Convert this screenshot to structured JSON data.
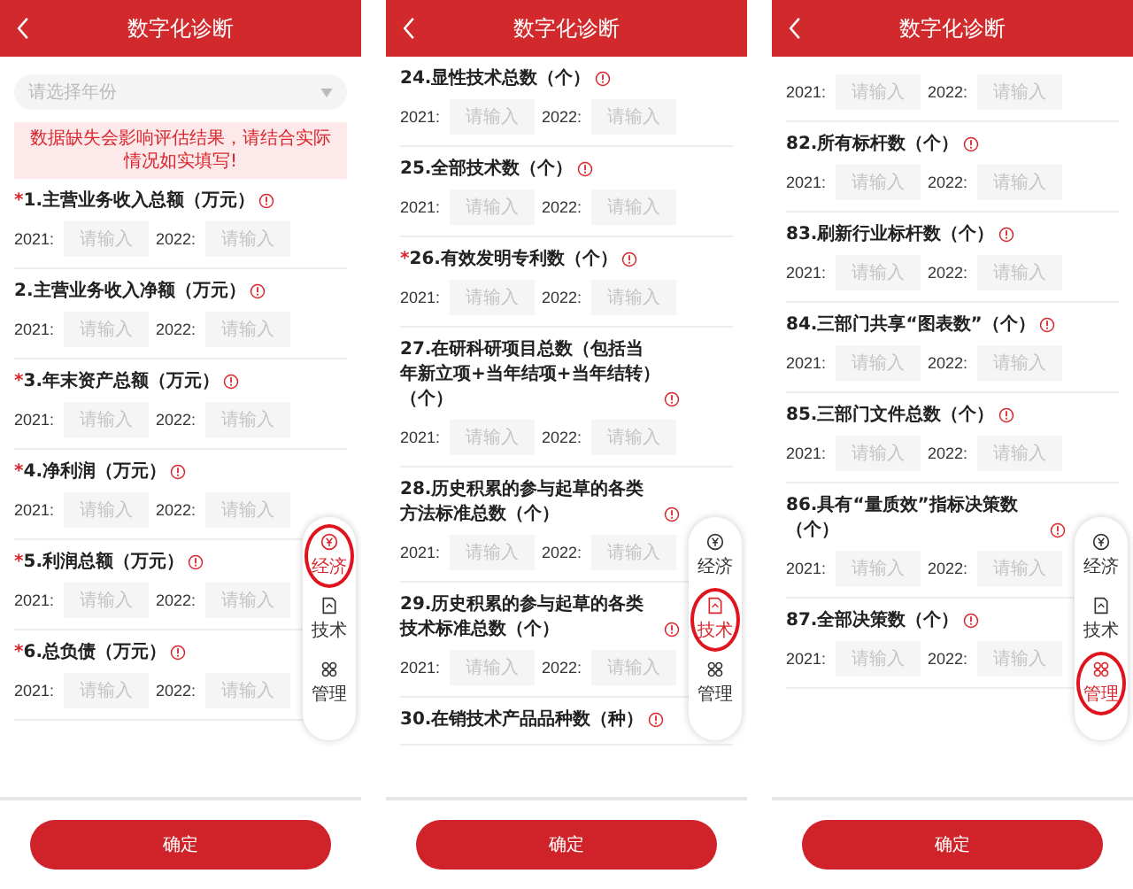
{
  "panels": [
    {
      "title": "数字化诊断",
      "year_select": {
        "placeholder": "请选择年份"
      },
      "notice": "数据缺失会影响评估结果，请结合实际情况如实填写!",
      "questions": [
        {
          "mark": "*",
          "label": "1.主营业务收入总额（万元）",
          "inputs": [
            {
              "year": "2021:",
              "placeholder": "请输入"
            },
            {
              "year": "2022:",
              "placeholder": "请输入"
            }
          ]
        },
        {
          "label": "2.主营业务收入净额（万元）",
          "inputs": [
            {
              "year": "2021:",
              "placeholder": "请输入"
            },
            {
              "year": "2022:",
              "placeholder": "请输入"
            }
          ]
        },
        {
          "mark": "*",
          "label": "3.年末资产总额（万元）",
          "inputs": [
            {
              "year": "2021:",
              "placeholder": "请输入"
            },
            {
              "year": "2022:",
              "placeholder": "请输入"
            }
          ]
        },
        {
          "mark": "*",
          "label": "4.净利润（万元）",
          "inputs": [
            {
              "year": "2021:",
              "placeholder": "请输入"
            },
            {
              "year": "2022:",
              "placeholder": "请输入"
            }
          ]
        },
        {
          "mark": "*",
          "label": "5.利润总额（万元）",
          "inputs": [
            {
              "year": "2021:",
              "placeholder": "请输入"
            },
            {
              "year": "2022:",
              "placeholder": "请输入"
            }
          ]
        },
        {
          "mark": "*",
          "label": "6.总负债（万元）",
          "inputs": [
            {
              "year": "2021:",
              "placeholder": "请输入"
            },
            {
              "year": "2022:",
              "placeholder": "请输入"
            }
          ]
        }
      ],
      "side_nav": [
        {
          "label": "经济",
          "selected": true
        },
        {
          "label": "技术",
          "selected": false
        },
        {
          "label": "管理",
          "selected": false
        }
      ],
      "confirm": "确定"
    },
    {
      "title": "数字化诊断",
      "questions": [
        {
          "label": "24.显性技术总数（个）",
          "inputs": [
            {
              "year": "2021:",
              "placeholder": "请输入"
            },
            {
              "year": "2022:",
              "placeholder": "请输入"
            }
          ]
        },
        {
          "label": "25.全部技术数（个）",
          "inputs": [
            {
              "year": "2021:",
              "placeholder": "请输入"
            },
            {
              "year": "2022:",
              "placeholder": "请输入"
            }
          ]
        },
        {
          "mark": "*",
          "label": "26.有效发明专利数（个）",
          "inputs": [
            {
              "year": "2021:",
              "placeholder": "请输入"
            },
            {
              "year": "2022:",
              "placeholder": "请输入"
            }
          ]
        },
        {
          "label": "27.在研科研项目总数（包括当年新立项+当年结项+当年结转）（个）",
          "inputs": [
            {
              "year": "2021:",
              "placeholder": "请输入"
            },
            {
              "year": "2022:",
              "placeholder": "请输入"
            }
          ]
        },
        {
          "label": "28.历史积累的参与起草的各类方法标准总数（个）",
          "inputs": [
            {
              "year": "2021:",
              "placeholder": "请输入"
            },
            {
              "year": "2022:",
              "placeholder": "请输入"
            }
          ]
        },
        {
          "label": "29.历史积累的参与起草的各类技术标准总数（个）",
          "inputs": [
            {
              "year": "2021:",
              "placeholder": "请输入"
            },
            {
              "year": "2022:",
              "placeholder": "请输入"
            }
          ]
        },
        {
          "label": "30.在销技术产品品种数（种）"
        }
      ],
      "side_nav": [
        {
          "label": "经济",
          "selected": false
        },
        {
          "label": "技术",
          "selected": true
        },
        {
          "label": "管理",
          "selected": false
        }
      ],
      "confirm": "确定"
    },
    {
      "title": "数字化诊断",
      "questions": [
        {
          "inputs": [
            {
              "year": "2021:",
              "placeholder": "请输入"
            },
            {
              "year": "2022:",
              "placeholder": "请输入"
            }
          ]
        },
        {
          "label": "82.所有标杆数（个）",
          "inputs": [
            {
              "year": "2021:",
              "placeholder": "请输入"
            },
            {
              "year": "2022:",
              "placeholder": "请输入"
            }
          ]
        },
        {
          "label": "83.刷新行业标杆数（个）",
          "inputs": [
            {
              "year": "2021:",
              "placeholder": "请输入"
            },
            {
              "year": "2022:",
              "placeholder": "请输入"
            }
          ]
        },
        {
          "label": "84.三部门共享“图表数”（个）",
          "inputs": [
            {
              "year": "2021:",
              "placeholder": "请输入"
            },
            {
              "year": "2022:",
              "placeholder": "请输入"
            }
          ]
        },
        {
          "label": "85.三部门文件总数（个）",
          "inputs": [
            {
              "year": "2021:",
              "placeholder": "请输入"
            },
            {
              "year": "2022:",
              "placeholder": "请输入"
            }
          ]
        },
        {
          "label": "86.具有“量质效”指标决策数（个）",
          "inputs": [
            {
              "year": "2021:",
              "placeholder": "请输入"
            },
            {
              "year": "2022:",
              "placeholder": "请输入"
            }
          ]
        },
        {
          "label": "87.全部决策数（个）",
          "inputs": [
            {
              "year": "2021:",
              "placeholder": "请输入"
            },
            {
              "year": "2022:",
              "placeholder": "请输入"
            }
          ]
        }
      ],
      "side_nav": [
        {
          "label": "经济",
          "selected": false
        },
        {
          "label": "技术",
          "selected": false
        },
        {
          "label": "管理",
          "selected": true
        }
      ],
      "confirm": "确定"
    }
  ]
}
